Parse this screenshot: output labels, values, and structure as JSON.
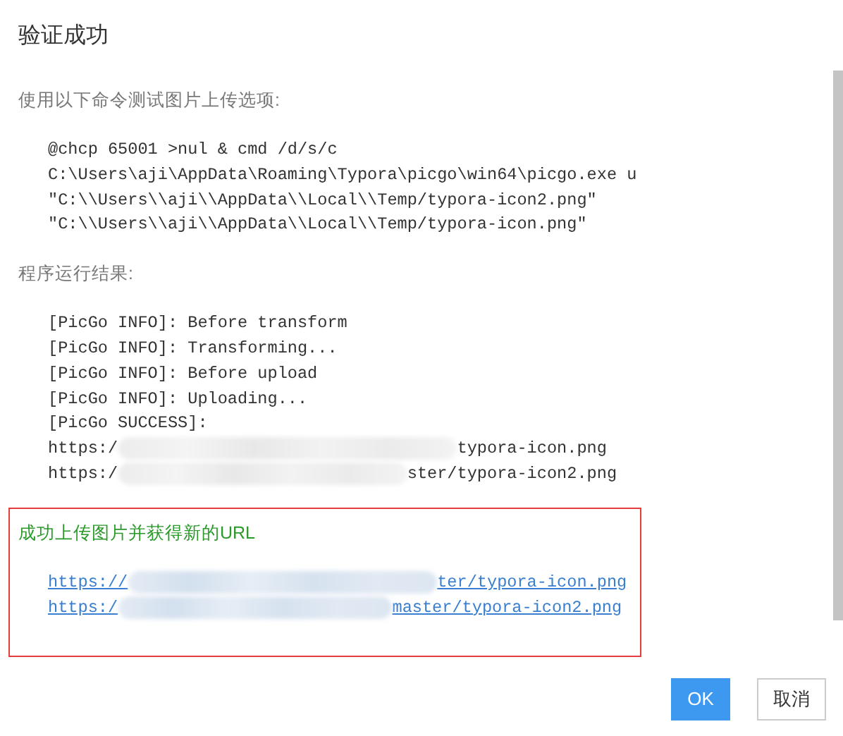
{
  "dialog": {
    "title": "验证成功",
    "command_intro": "使用以下命令测试图片上传选项:",
    "command_lines": [
      "@chcp 65001 >nul & cmd /d/s/c",
      "C:\\Users\\aji\\AppData\\Roaming\\Typora\\picgo\\win64\\picgo.exe u",
      "\"C:\\\\Users\\\\aji\\\\AppData\\\\Local\\\\Temp/typora-icon2.png\"",
      "\"C:\\\\Users\\\\aji\\\\AppData\\\\Local\\\\Temp/typora-icon.png\""
    ],
    "result_intro": "程序运行结果:",
    "result_lines": [
      {
        "kind": "text",
        "text": "[PicGo INFO]: Before transform"
      },
      {
        "kind": "text",
        "text": "[PicGo INFO]: Transforming..."
      },
      {
        "kind": "text",
        "text": "[PicGo INFO]: Before upload"
      },
      {
        "kind": "text",
        "text": "[PicGo INFO]: Uploading..."
      },
      {
        "kind": "text",
        "text": "[PicGo SUCCESS]:"
      },
      {
        "kind": "blurred",
        "start": "https:/",
        "end": "typora-icon.png"
      },
      {
        "kind": "blurred",
        "start": "https:/",
        "end": "ster/typora-icon2.png"
      }
    ],
    "success": {
      "message": "成功上传图片并获得新的URL",
      "links": [
        {
          "start": "https://",
          "end": "ter/typora-icon.png"
        },
        {
          "start": "https:/",
          "end": "master/typora-icon2.png"
        }
      ]
    },
    "buttons": [
      {
        "label": "OK",
        "kind": "primary"
      },
      {
        "label": "取消",
        "kind": "secondary"
      }
    ]
  }
}
